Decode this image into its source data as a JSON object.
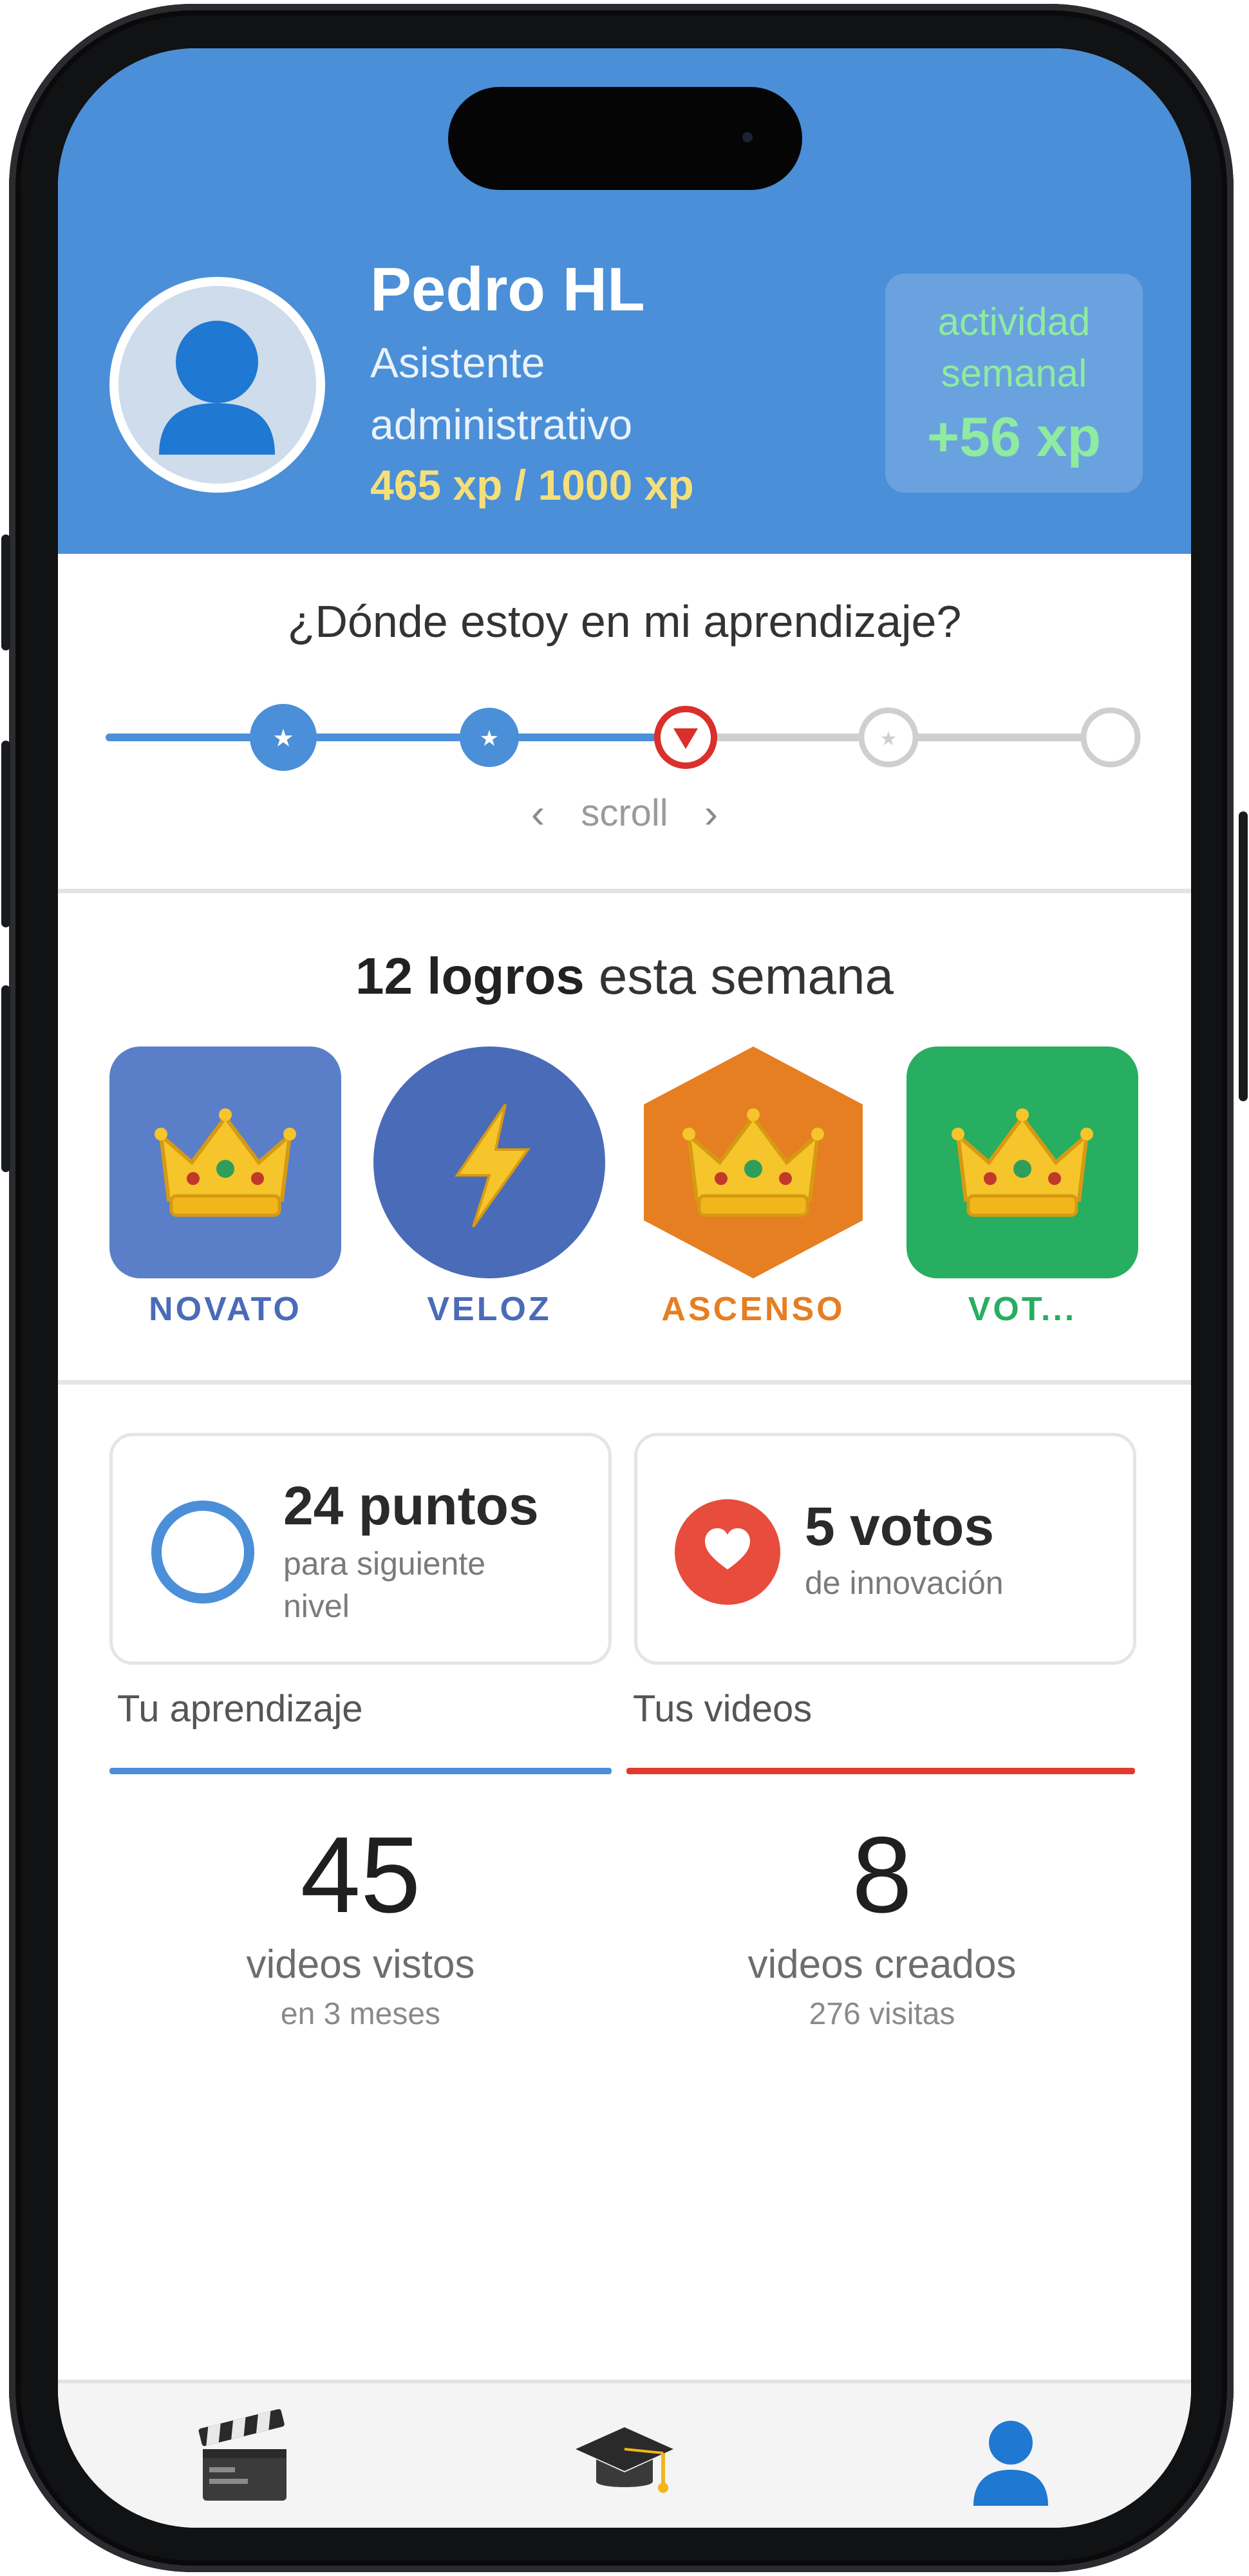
{
  "profile": {
    "name": "Pedro HL",
    "role": "Asistente administrativo",
    "xp": "465 xp / 1000 xp",
    "avatar_icon": "user-silhouette-icon"
  },
  "weekly_activity": {
    "label": "actividad semanal",
    "value": "+56 xp"
  },
  "learning_path": {
    "title": "¿Dónde estoy en mi aprendizaje?",
    "scroll_label": "scroll",
    "scroll_left_icon": "chevron-left-icon",
    "scroll_right_icon": "chevron-right-icon",
    "steps": [
      {
        "state": "completed",
        "icon": "star-icon"
      },
      {
        "state": "completed",
        "icon": "star-icon"
      },
      {
        "state": "current",
        "icon": "arrow-down-icon"
      },
      {
        "state": "locked",
        "icon": "star-icon"
      },
      {
        "state": "locked",
        "icon": "none"
      }
    ],
    "progress_color": "#4a8fd8",
    "current_color": "#d9302b",
    "locked_color": "#cfcfcf"
  },
  "achievements": {
    "title_bold": "12 logros",
    "title_rest": " esta semana",
    "badges": [
      {
        "label": "NOVATO",
        "shape": "rounded-square",
        "icon": "crown-icon",
        "color": "#5a7fc8",
        "label_color": "#4a6bb8"
      },
      {
        "label": "VELOZ",
        "shape": "circle",
        "icon": "lightning-icon",
        "color": "#4a6bb8",
        "label_color": "#4a6bb8"
      },
      {
        "label": "ASCENSO",
        "shape": "hexagon",
        "icon": "crown-icon",
        "color": "#e67e22",
        "label_color": "#e67e22"
      },
      {
        "label": "VOT...",
        "shape": "rounded-square",
        "icon": "crown-icon",
        "color": "#27ae60",
        "label_color": "#27ae60"
      }
    ]
  },
  "stats": {
    "points": {
      "title": "24 puntos",
      "subtitle": "para siguiente nivel",
      "icon": "ring-icon",
      "color": "#4a8fd8"
    },
    "votes": {
      "title": "5 votos",
      "subtitle": "de innovación",
      "icon": "heart-icon",
      "color": "#e74c3c"
    }
  },
  "learning": {
    "label": "Tu aprendizaje",
    "number": "45",
    "caption": "videos vistos",
    "sub": "en 3 meses",
    "color": "#4a8fd8"
  },
  "videos": {
    "label": "Tus videos",
    "number": "8",
    "caption": "videos creados",
    "sub": "276 visitas",
    "color": "#e03a2f"
  },
  "nav": {
    "items": [
      {
        "icon": "clapperboard-icon"
      },
      {
        "icon": "graduation-cap-icon"
      },
      {
        "icon": "user-icon",
        "active": true
      }
    ]
  }
}
